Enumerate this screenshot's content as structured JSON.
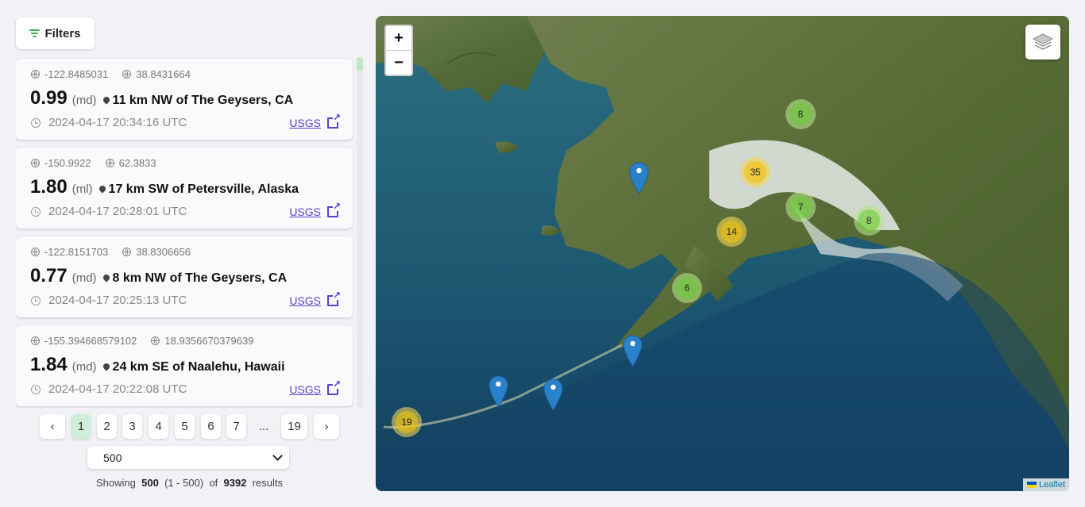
{
  "filters": {
    "label": "Filters",
    "icon": "filter-icon"
  },
  "events": [
    {
      "lon": "-122.8485031",
      "lat": "38.8431664",
      "mag": "0.99",
      "magtype": "(md)",
      "place": "11 km NW of The Geysers, CA",
      "time": "2024-04-17 20:34:16 UTC",
      "source": "USGS"
    },
    {
      "lon": "-150.9922",
      "lat": "62.3833",
      "mag": "1.80",
      "magtype": "(ml)",
      "place": "17 km SW of Petersville, Alaska",
      "time": "2024-04-17 20:28:01 UTC",
      "source": "USGS"
    },
    {
      "lon": "-122.8151703",
      "lat": "38.8306656",
      "mag": "0.77",
      "magtype": "(md)",
      "place": "8 km NW of The Geysers, CA",
      "time": "2024-04-17 20:25:13 UTC",
      "source": "USGS"
    },
    {
      "lon": "-155.394668579102",
      "lat": "18.9356670379639",
      "mag": "1.84",
      "magtype": "(md)",
      "place": "24 km SE of Naalehu, Hawaii",
      "time": "2024-04-17 20:22:08 UTC",
      "source": "USGS"
    }
  ],
  "pagination": {
    "prev": "‹",
    "next": "›",
    "pages": [
      "1",
      "2",
      "3",
      "4",
      "5",
      "6",
      "7",
      "...",
      "19"
    ],
    "active": "1"
  },
  "page_size": {
    "selected": "500"
  },
  "summary": {
    "showing": "Showing",
    "count": "500",
    "range": "(1 - 500)",
    "of": "of",
    "total": "9392",
    "results": "results"
  },
  "map": {
    "zoom_in": "+",
    "zoom_out": "−",
    "attribution": "Leaflet",
    "clusters": [
      "8",
      "35",
      "7",
      "8",
      "14",
      "6",
      "19"
    ],
    "colors": {
      "cluster_green": "#6ecc39",
      "cluster_yellow": "#f0c20c",
      "marker": "#2a81cb",
      "water": "#1f5f74",
      "land": "#5a6f3a"
    }
  }
}
